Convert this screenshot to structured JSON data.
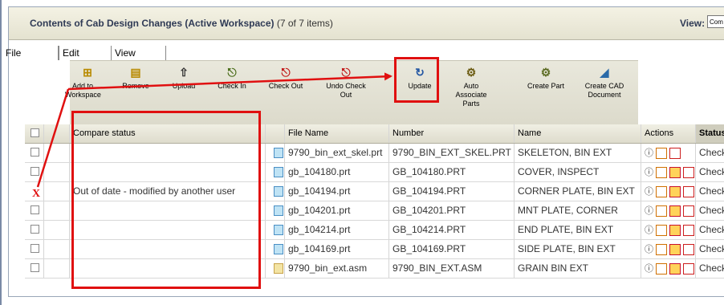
{
  "header": {
    "title": "Contents of Cab Design Changes (Active Workspace)",
    "count": "(7 of 7 items)",
    "view_label": "View:",
    "view_value": "Com"
  },
  "menu": [
    "File",
    "Edit",
    "View"
  ],
  "toolbar": [
    {
      "label": "Add to Workspace",
      "icon": "add-to-workspace-icon"
    },
    {
      "label": "Remove",
      "icon": "remove-icon"
    },
    {
      "label": "Upload",
      "icon": "upload-icon"
    },
    {
      "label": "Check In",
      "icon": "check-in-icon"
    },
    {
      "label": "Check Out",
      "icon": "check-out-icon"
    },
    {
      "label": "Undo Check Out",
      "icon": "undo-check-out-icon"
    },
    {
      "label": "Update",
      "icon": "update-icon"
    },
    {
      "label": "Auto Associate Parts",
      "icon": "auto-associate-icon"
    },
    {
      "label": "Create Part",
      "icon": "create-part-icon"
    },
    {
      "label": "Create CAD Document",
      "icon": "create-cad-icon"
    }
  ],
  "table": {
    "columns": [
      "Compare status",
      "File Name",
      "Number",
      "Name",
      "Actions",
      "Status"
    ],
    "compare_status_text": "Out of date - modified by another user",
    "rows": [
      {
        "file": "9790_bin_ext_skel.prt",
        "number": "9790_BIN_EXT_SKEL.PRT",
        "name": "SKELETON, BIN EXT",
        "status": "Checke",
        "type": "prt"
      },
      {
        "file": "gb_104180.prt",
        "number": "GB_104180.PRT",
        "name": "COVER, INSPECT",
        "status": "Checke",
        "type": "prt"
      },
      {
        "file": "gb_104194.prt",
        "number": "GB_104194.PRT",
        "name": "CORNER PLATE, BIN EXT",
        "status": "Checke",
        "type": "prt"
      },
      {
        "file": "gb_104201.prt",
        "number": "GB_104201.PRT",
        "name": "MNT PLATE, CORNER",
        "status": "Checke",
        "type": "prt"
      },
      {
        "file": "gb_104214.prt",
        "number": "GB_104214.PRT",
        "name": "END PLATE, BIN EXT",
        "status": "Checke",
        "type": "prt"
      },
      {
        "file": "gb_104169.prt",
        "number": "GB_104169.PRT",
        "name": "SIDE PLATE, BIN EXT",
        "status": "Checke",
        "type": "prt"
      },
      {
        "file": "9790_bin_ext.asm",
        "number": "9790_BIN_EXT.ASM",
        "name": "GRAIN BIN EXT",
        "status": "Checke",
        "type": "asm"
      }
    ],
    "x_mark": "X"
  },
  "colors": {
    "annotation": "#e01010",
    "title": "#2f3a55"
  }
}
